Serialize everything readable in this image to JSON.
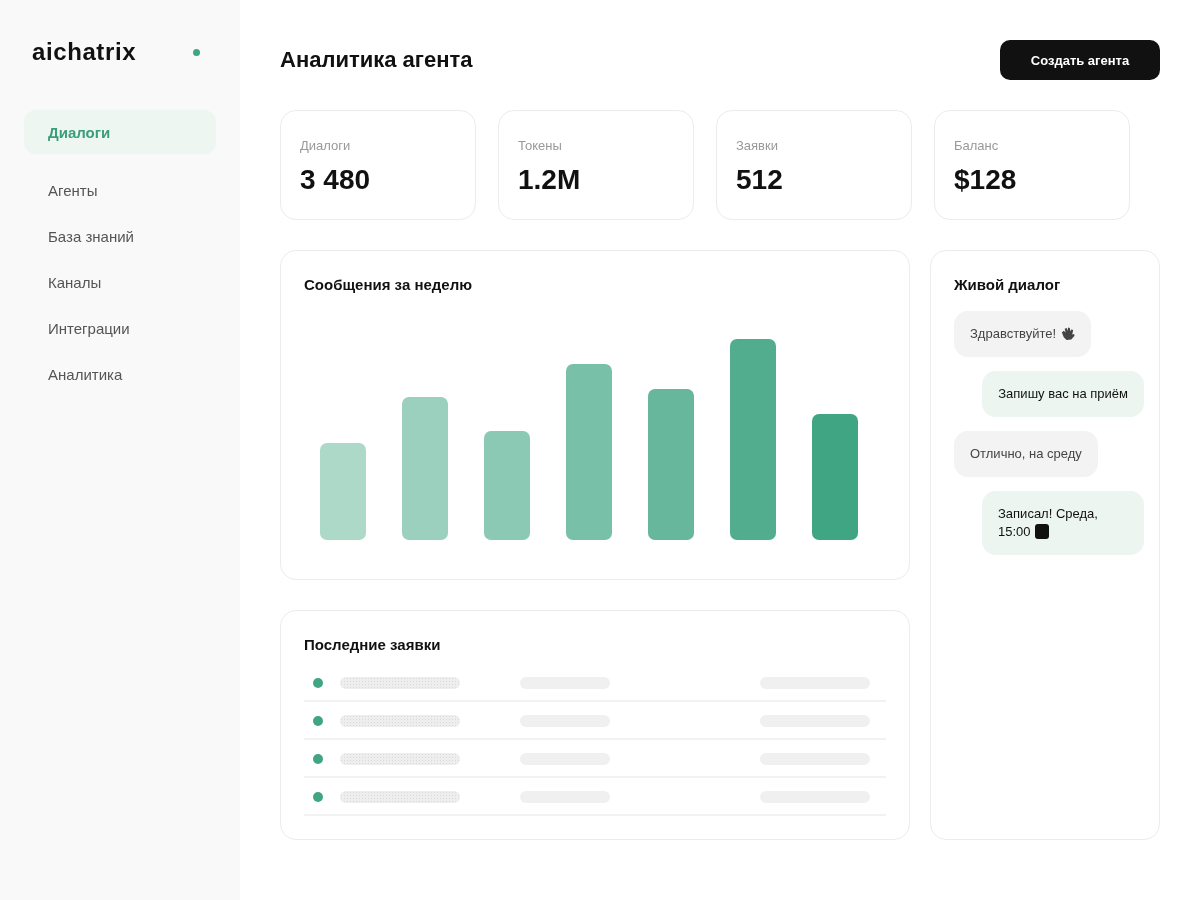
{
  "sidebar": {
    "logo": "aichatrix",
    "items": [
      {
        "label": "Диалоги",
        "selected": true
      },
      {
        "label": "Агенты",
        "selected": false
      },
      {
        "label": "База знаний",
        "selected": false
      },
      {
        "label": "Каналы",
        "selected": false
      },
      {
        "label": "Интеграции",
        "selected": false
      },
      {
        "label": "Аналитика",
        "selected": false
      }
    ]
  },
  "header": {
    "title": "Аналитика агента",
    "button": "Создать агента"
  },
  "stats": [
    {
      "label": "Диалоги",
      "value": "3 480"
    },
    {
      "label": "Токены",
      "value": "1.2M"
    },
    {
      "label": "Заявки",
      "value": "512"
    },
    {
      "label": "Баланс",
      "value": "$128"
    }
  ],
  "messages_chart": {
    "title": "Сообщения за неделю"
  },
  "live_dialog": {
    "title": "Живой диалог",
    "messages": [
      {
        "kind": "incoming",
        "text": "Здравствуйте!",
        "emoji": {
          "kind": "wave"
        }
      },
      {
        "kind": "outgoing",
        "text": "Запишу вас на приём"
      },
      {
        "kind": "incoming",
        "text": "Отлично, на среду"
      },
      {
        "kind": "outgoing",
        "text": "Записал! Среда, 15:00",
        "emoji": {
          "kind": "square"
        }
      }
    ]
  },
  "recent_requests": {
    "title": "Последние заявки",
    "rows": [
      {
        "color": "#3fa582"
      },
      {
        "color": "#3fa582"
      },
      {
        "color": "#3fa582"
      },
      {
        "color": "#3fa582"
      }
    ]
  }
}
